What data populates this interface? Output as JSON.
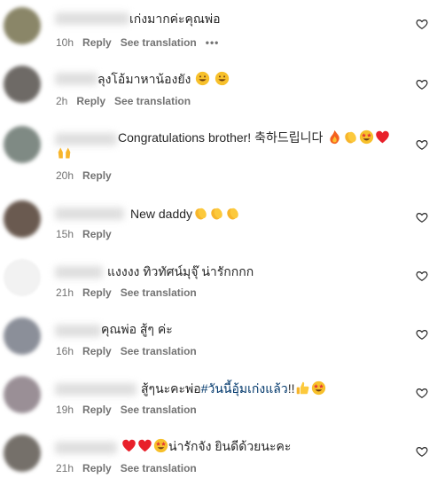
{
  "comments": [
    {
      "text": "เก่งมากค่ะคุณพ่อ",
      "time": "10h",
      "reply": "Reply",
      "translate": "See translation",
      "more": "•••",
      "emojis": [],
      "avatar_color": "#8a8668"
    },
    {
      "text": "ลุงโอ้มาหาน้องยัง",
      "time": "2h",
      "reply": "Reply",
      "translate": "See translation",
      "emojis": [
        "grin-sweat",
        "grin-sweat"
      ],
      "avatar_color": "#6e6a66"
    },
    {
      "text": "Congratulations brother! 축하드립니다",
      "time": "20h",
      "reply": "Reply",
      "emojis": [
        "fire",
        "clap",
        "star-eyes",
        "red-heart"
      ],
      "line2_emojis": [
        "raised-hands"
      ],
      "avatar_color": "#7f8a84"
    },
    {
      "text": "New daddy",
      "time": "15h",
      "reply": "Reply",
      "emojis": [
        "clap",
        "clap",
        "clap"
      ],
      "avatar_color": "#6a5a50"
    },
    {
      "text": "แงงงง ทิวทัศน์มุจุ๊ น่ารักกกก",
      "time": "21h",
      "reply": "Reply",
      "translate": "See translation",
      "emojis": [],
      "avatar_color": "#f2f2f2"
    },
    {
      "text": "คุณพ่อ สู้ๆ ค่ะ",
      "time": "16h",
      "reply": "Reply",
      "translate": "See translation",
      "emojis": [],
      "avatar_color": "#8b8f99"
    },
    {
      "text_before": "สู้ๆนะคะพ่อ",
      "hashtag": "#วันนี้อุ้มเก่งแล้ว",
      "text_after": "!!",
      "time": "19h",
      "reply": "Reply",
      "translate": "See translation",
      "emojis": [
        "thumbs-up",
        "star-eyes"
      ],
      "avatar_color": "#9a8f96"
    },
    {
      "text": "น่ารักจัง ยินดีด้วยนะคะ",
      "time": "21h",
      "reply": "Reply",
      "translate": "See translation",
      "emojis_before": [
        "red-heart",
        "red-heart",
        "star-eyes"
      ],
      "avatar_color": "#75706a"
    }
  ],
  "colors": {
    "hashtag": "#00376b",
    "meta": "#737373",
    "text": "#262626"
  }
}
